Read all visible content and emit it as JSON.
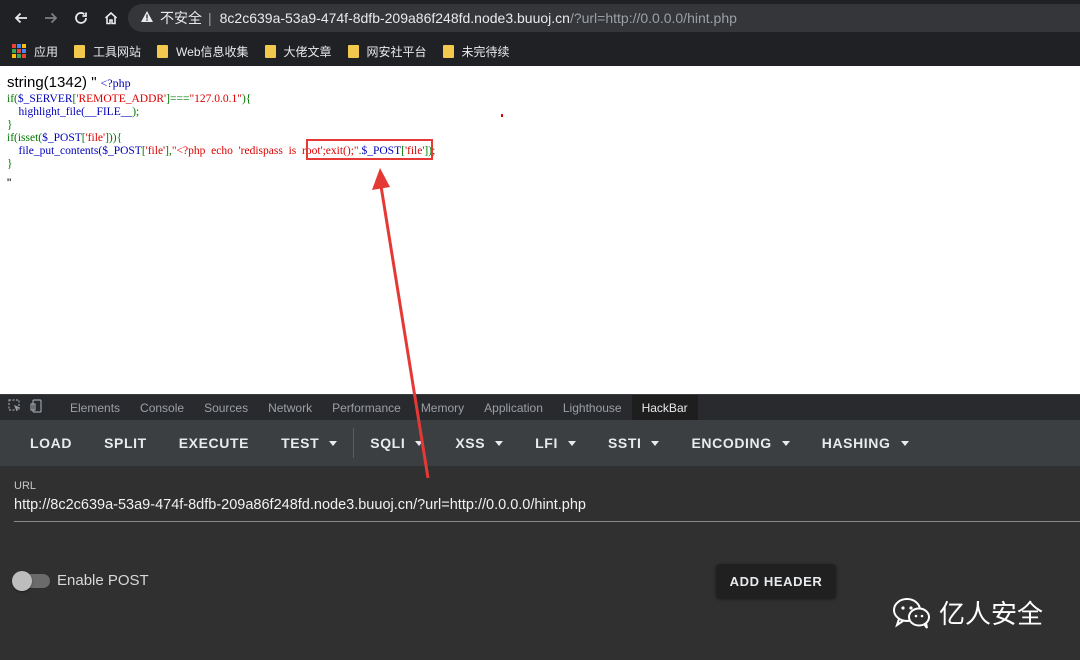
{
  "browser": {
    "security_label": "不安全",
    "url_host": "8c2c639a-53a9-474f-8dfb-209a86f248fd.node3.buuoj.cn",
    "url_path": "/?url=http://0.0.0.0/hint.php"
  },
  "bookmarks": [
    {
      "label": "应用",
      "icon": "apps-grid-icon"
    },
    {
      "label": "工具网站",
      "icon": "folder-icon"
    },
    {
      "label": "Web信息收集",
      "icon": "folder-icon"
    },
    {
      "label": "大佬文章",
      "icon": "folder-icon"
    },
    {
      "label": "网安社平台",
      "icon": "folder-icon"
    },
    {
      "label": "未完待续",
      "icon": "folder-icon"
    }
  ],
  "page": {
    "string_prefix": "string(1342) \"",
    "php_open": "<?php",
    "line1_kw": "if(",
    "line1_var": "$_SERVER",
    "line1_bracket": "[",
    "line1_str1": "'REMOTE_ADDR'",
    "line1_op": "]===",
    "line1_str2": "\"127.0.0.1\"",
    "line1_end": "){",
    "line2_indent": "    ",
    "line2_fn": "highlight_file(",
    "line2_const": "__FILE__",
    "line2_end": ");",
    "line3": "}",
    "line4_kw": "if(isset(",
    "line4_var": "$_POST",
    "line4_bracket": "[",
    "line4_str": "'file'",
    "line4_end": "])){",
    "line5_indent": "    ",
    "line5_fn": "file_put_contents(",
    "line5_var": "$_POST",
    "line5_bracket": "[",
    "line5_str1": "'file'",
    "line5_mid": "],",
    "line5_str2": "\"<?php  echo  ",
    "line5_str3": "'redispass  is  root'",
    "line5_str4": ";exit();\"",
    "line5_concat": ".",
    "line5_var2": "$_POST",
    "line5_bracket2": "[",
    "line5_str5": "'file'",
    "line5_end": "]);",
    "line6": "}",
    "quote_end": "\""
  },
  "devtools": {
    "tabs": [
      "Elements",
      "Console",
      "Sources",
      "Network",
      "Performance",
      "Memory",
      "Application",
      "Lighthouse",
      "HackBar"
    ],
    "active_tab": "HackBar"
  },
  "hackbar": {
    "menu": [
      {
        "label": "LOAD",
        "dropdown": false
      },
      {
        "label": "SPLIT",
        "dropdown": false
      },
      {
        "label": "EXECUTE",
        "dropdown": false
      },
      {
        "label": "TEST",
        "dropdown": true
      },
      {
        "label": "SQLI",
        "dropdown": true
      },
      {
        "label": "XSS",
        "dropdown": true
      },
      {
        "label": "LFI",
        "dropdown": true
      },
      {
        "label": "SSTI",
        "dropdown": true
      },
      {
        "label": "ENCODING",
        "dropdown": true
      },
      {
        "label": "HASHING",
        "dropdown": true
      }
    ],
    "url_label": "URL",
    "url_value": "http://8c2c639a-53a9-474f-8dfb-209a86f248fd.node3.buuoj.cn/?url=http://0.0.0.0/hint.php",
    "enable_post_label": "Enable POST",
    "enable_post_on": false,
    "add_header_label": "ADD HEADER"
  },
  "watermark": {
    "text": "亿人安全",
    "icon": "wechat-icon"
  },
  "colors": {
    "annotation_red": "#e53935"
  }
}
